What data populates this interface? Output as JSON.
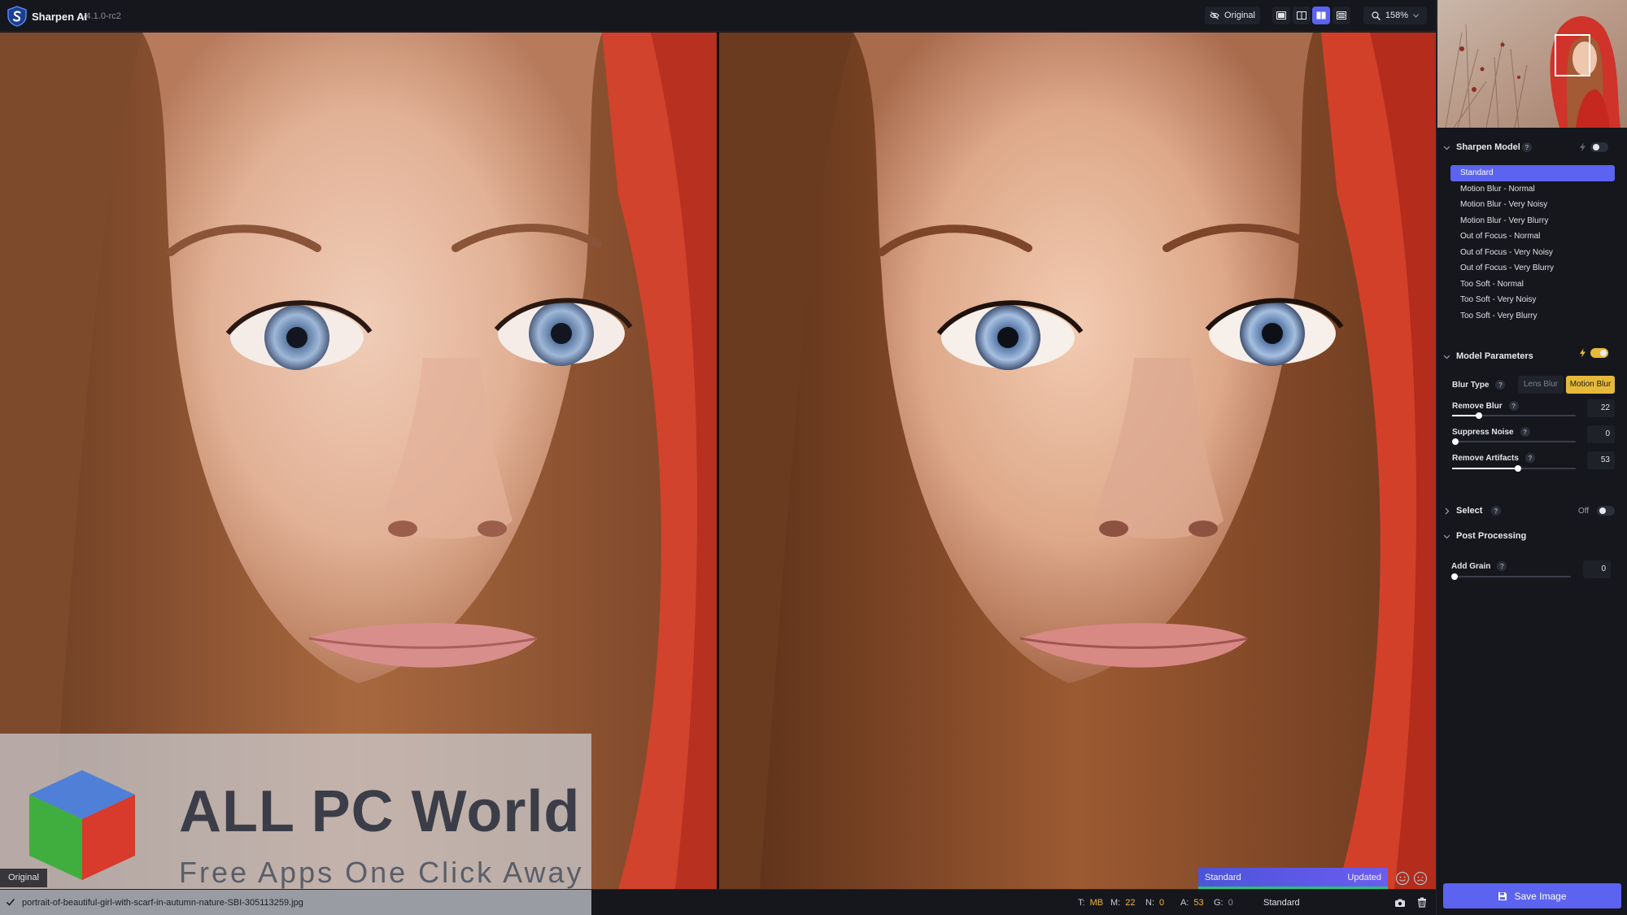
{
  "app": {
    "name": "Sharpen AI",
    "version": "v4.1.0-rc2"
  },
  "toolbar": {
    "original_label": "Original",
    "zoom": "158%"
  },
  "watermark": {
    "title": "ALL PC World",
    "tagline": "Free Apps One Click Away"
  },
  "panels": {
    "left_label": "Original"
  },
  "result": {
    "model": "Standard",
    "status": "Updated"
  },
  "status_bar": {
    "filename": "portrait-of-beautiful-girl-with-scarf-in-autumn-nature-SBI-305113259.jpg",
    "stats": [
      {
        "key": "T:",
        "value": "MB"
      },
      {
        "key": "M:",
        "value": "22"
      },
      {
        "key": "N:",
        "value": "0"
      },
      {
        "key": "A:",
        "value": "53"
      },
      {
        "key": "G:",
        "value": "0"
      }
    ],
    "model": "Standard"
  },
  "sidebar": {
    "sharpen_model": {
      "title": "Sharpen Model",
      "help": "?",
      "models": [
        "Standard",
        "Motion Blur - Normal",
        "Motion Blur - Very Noisy",
        "Motion Blur - Very Blurry",
        "Out of Focus - Normal",
        "Out of Focus - Very Noisy",
        "Out of Focus - Very Blurry",
        "Too Soft - Normal",
        "Too Soft - Very Noisy",
        "Too Soft - Very Blurry"
      ],
      "selected_index": 0
    },
    "model_parameters": {
      "title": "Model Parameters",
      "help": "?",
      "blur_type_label": "Blur Type",
      "blur_types": [
        "Lens Blur",
        "Motion Blur"
      ],
      "selected_blur_type": "Motion Blur",
      "remove_blur": {
        "label": "Remove Blur",
        "value": "22",
        "fraction": 0.22
      },
      "suppress_noise": {
        "label": "Suppress Noise",
        "value": "0",
        "fraction": 0.0
      },
      "remove_artifacts": {
        "label": "Remove Artifacts",
        "value": "53",
        "fraction": 0.53
      }
    },
    "select": {
      "title": "Select",
      "help": "?",
      "state": "Off"
    },
    "post_processing": {
      "title": "Post Processing",
      "add_grain": {
        "label": "Add Grain",
        "help": "?",
        "value": "0",
        "fraction": 0.0
      }
    },
    "save_label": "Save Image"
  },
  "colors": {
    "accent": "#5b63f0",
    "highlight": "#e7b93a",
    "success": "#28c27a"
  }
}
